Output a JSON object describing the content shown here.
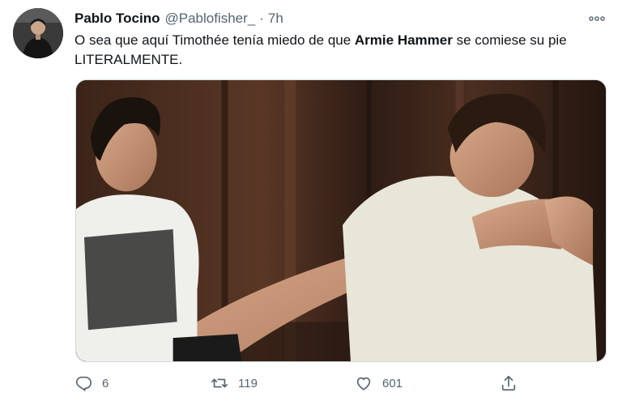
{
  "tweet": {
    "display_name": "Pablo Tocino",
    "handle": "@Pablofisher_",
    "separator": "·",
    "time": "7h",
    "text_part1": "O sea que aquí Timothée tenía miedo de que ",
    "text_bold": "Armie Hammer",
    "text_part2": " se comiese su pie LITERALMENTE.",
    "avatar_icon": "user-avatar-photo",
    "more_icon": "more-options-icon",
    "media_description_icon": "attached-photo"
  },
  "actions": {
    "reply": {
      "icon": "reply-icon",
      "count": "6"
    },
    "retweet": {
      "icon": "retweet-icon",
      "count": "119"
    },
    "like": {
      "icon": "heart-icon",
      "count": "601"
    },
    "share": {
      "icon": "share-icon"
    }
  },
  "colors": {
    "text_primary": "#0f1419",
    "text_secondary": "#536471",
    "border": "#cfd9de"
  }
}
